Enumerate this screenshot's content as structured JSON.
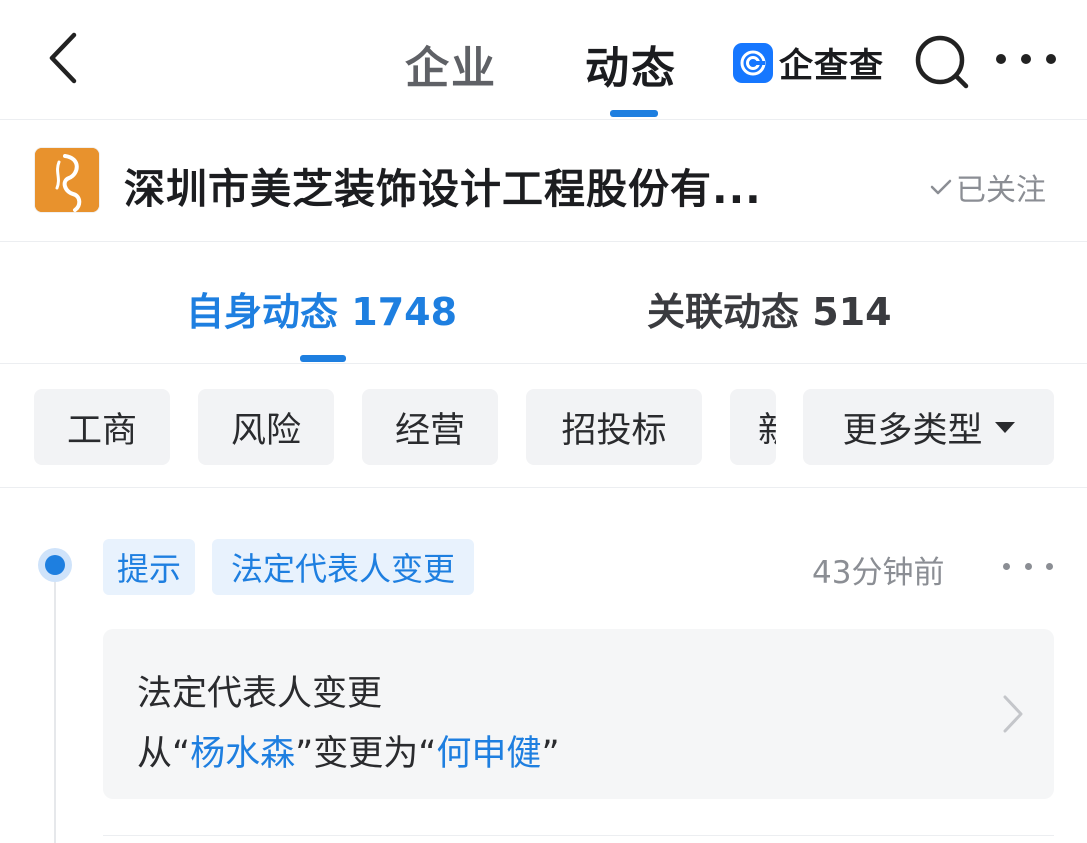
{
  "nav": {
    "tab_enterprise": "企业",
    "tab_dynamics": "动态",
    "brand_name": "企查查",
    "accent": "#1e7fe0"
  },
  "company": {
    "name": "深圳市美芝装饰设计工程股份有...",
    "follow_label": "已关注"
  },
  "subtabs": {
    "self_label": "自身动态",
    "self_count": "1748",
    "related_label": "关联动态",
    "related_count": "514"
  },
  "filters": {
    "chips": [
      "工商",
      "风险",
      "经营",
      "招投标",
      "新"
    ],
    "more_label": "更多类型"
  },
  "feed": {
    "items": [
      {
        "tag_primary": "提示",
        "tag_secondary": "法定代表人变更",
        "time": "43分钟前",
        "card_title": "法定代表人变更",
        "desc_prefix": "从“",
        "from_name": "杨水森",
        "desc_middle": "”变更为“",
        "to_name": "何申健",
        "desc_suffix": "”"
      }
    ]
  }
}
